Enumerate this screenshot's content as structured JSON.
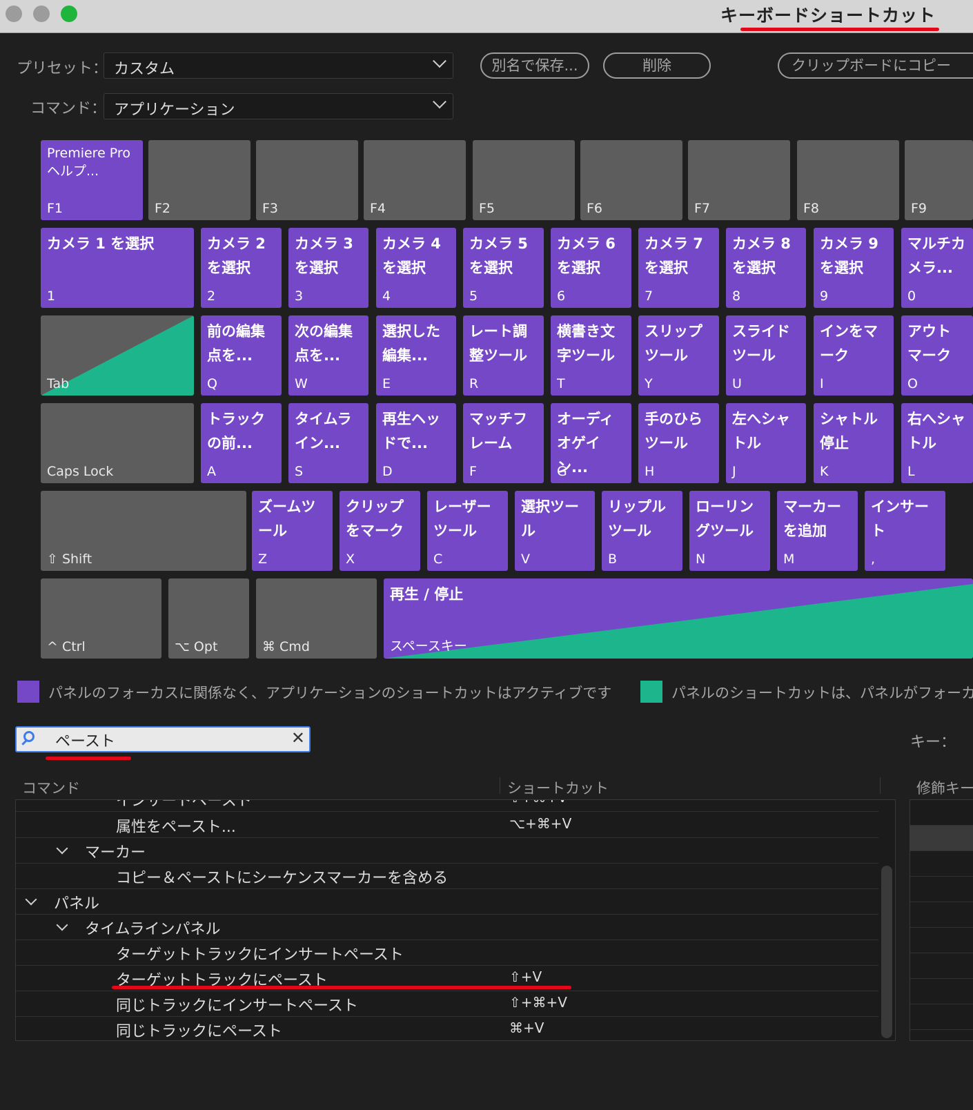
{
  "window": {
    "title": "キーボードショートカット"
  },
  "toolbar": {
    "preset_label": "プリセット：",
    "preset_value": "カスタム",
    "command_label": "コマンド：",
    "command_value": "アプリケーション",
    "save_as": "別名で保存...",
    "delete": "削除",
    "copy_clipboard": "クリップボードにコピー"
  },
  "keyboard": {
    "f1": {
      "cmd": "Premiere Pro\nヘルプ...",
      "key": "F1"
    },
    "f2": {
      "key": "F2"
    },
    "f3": {
      "key": "F3"
    },
    "f4": {
      "key": "F4"
    },
    "f5": {
      "key": "F5"
    },
    "f6": {
      "key": "F6"
    },
    "f7": {
      "key": "F7"
    },
    "f8": {
      "key": "F8"
    },
    "f9": {
      "key": "F9"
    },
    "k1": {
      "cmd": "カメラ 1 を選択",
      "key": "1"
    },
    "k2": {
      "cmd": "カメラ 2\nを選択",
      "key": "2"
    },
    "k3": {
      "cmd": "カメラ 3\nを選択",
      "key": "3"
    },
    "k4": {
      "cmd": "カメラ 4\nを選択",
      "key": "4"
    },
    "k5": {
      "cmd": "カメラ 5\nを選択",
      "key": "5"
    },
    "k6": {
      "cmd": "カメラ 6\nを選択",
      "key": "6"
    },
    "k7": {
      "cmd": "カメラ 7\nを選択",
      "key": "7"
    },
    "k8": {
      "cmd": "カメラ 8\nを選択",
      "key": "8"
    },
    "k9": {
      "cmd": "カメラ 9\nを選択",
      "key": "9"
    },
    "k0": {
      "cmd": "マルチカ\nメラ...",
      "key": "0"
    },
    "tab": {
      "key": "Tab"
    },
    "q": {
      "cmd": "前の編集\n点を...",
      "key": "Q"
    },
    "w": {
      "cmd": "次の編集\n点を...",
      "key": "W"
    },
    "e": {
      "cmd": "選択した\n編集...",
      "key": "E"
    },
    "r": {
      "cmd": "レート調\n整ツール",
      "key": "R"
    },
    "t": {
      "cmd": "横書き文\n字ツール",
      "key": "T"
    },
    "y": {
      "cmd": "スリップ\nツール",
      "key": "Y"
    },
    "u": {
      "cmd": "スライド\nツール",
      "key": "U"
    },
    "i": {
      "cmd": "インをマ\nーク",
      "key": "I"
    },
    "o": {
      "cmd": "アウト\nマーク",
      "key": "O"
    },
    "caps": {
      "key": "Caps Lock"
    },
    "a": {
      "cmd": "トラック\nの前...",
      "key": "A"
    },
    "s": {
      "cmd": "タイムラ\nイン...",
      "key": "S"
    },
    "d": {
      "cmd": "再生ヘッ\nドで...",
      "key": "D"
    },
    "f": {
      "cmd": "マッチフ\nレーム",
      "key": "F"
    },
    "g": {
      "cmd": "オーディ\nオゲイン...",
      "key": "G"
    },
    "h": {
      "cmd": "手のひら\nツール",
      "key": "H"
    },
    "j": {
      "cmd": "左へシャ\nトル",
      "key": "J"
    },
    "k": {
      "cmd": "シャトル\n停止",
      "key": "K"
    },
    "l": {
      "cmd": "右へシャ\nトル",
      "key": "L"
    },
    "shift": {
      "key": "⇧ Shift"
    },
    "z": {
      "cmd": "ズームツ\nール",
      "key": "Z"
    },
    "x": {
      "cmd": "クリップ\nをマーク",
      "key": "X"
    },
    "c": {
      "cmd": "レーザー\nツール",
      "key": "C"
    },
    "v": {
      "cmd": "選択ツー\nル",
      "key": "V"
    },
    "b": {
      "cmd": "リップル\nツール",
      "key": "B"
    },
    "n": {
      "cmd": "ローリン\nグツール",
      "key": "N"
    },
    "m": {
      "cmd": "マーカー\nを追加",
      "key": "M"
    },
    "comma": {
      "cmd": "インサー\nト",
      "key": ","
    },
    "ctrl": {
      "key": "^ Ctrl"
    },
    "opt": {
      "key": "⌥ Opt"
    },
    "cmdkey": {
      "key": "⌘ Cmd"
    },
    "space": {
      "cmd": "再生 / 停止",
      "key": "スペースキー"
    }
  },
  "legend": {
    "app_text": "パネルのフォーカスに関係なく、アプリケーションのショートカットはアクティブです",
    "panel_text": "パネルのショートカットは、パネルがフォーカスされている場合のみアクティブです",
    "app_color": "#7448c6",
    "panel_color": "#1db68c"
  },
  "search": {
    "value": "ペースト",
    "clear": "✕",
    "key_label": "キー："
  },
  "table": {
    "col_command": "コマンド",
    "col_shortcut": "ショートカット",
    "col_modifier": "修飾キー",
    "rows": [
      {
        "cmd": "インサートペースト",
        "shortcut": "⇧+⌘+V"
      },
      {
        "cmd": "属性をペースト...",
        "shortcut": "⌥+⌘+V"
      },
      {
        "cmd": "マーカー",
        "shortcut": ""
      },
      {
        "cmd": "コピー＆ペーストにシーケンスマーカーを含める",
        "shortcut": ""
      },
      {
        "cmd": "パネル",
        "shortcut": ""
      },
      {
        "cmd": "タイムラインパネル",
        "shortcut": ""
      },
      {
        "cmd": "ターゲットトラックにインサートペースト",
        "shortcut": ""
      },
      {
        "cmd": "ターゲットトラックにペースト",
        "shortcut": "⇧+V"
      },
      {
        "cmd": "同じトラックにインサートペースト",
        "shortcut": "⇧+⌘+V"
      },
      {
        "cmd": "同じトラックにペースト",
        "shortcut": "⌘+V"
      }
    ]
  }
}
